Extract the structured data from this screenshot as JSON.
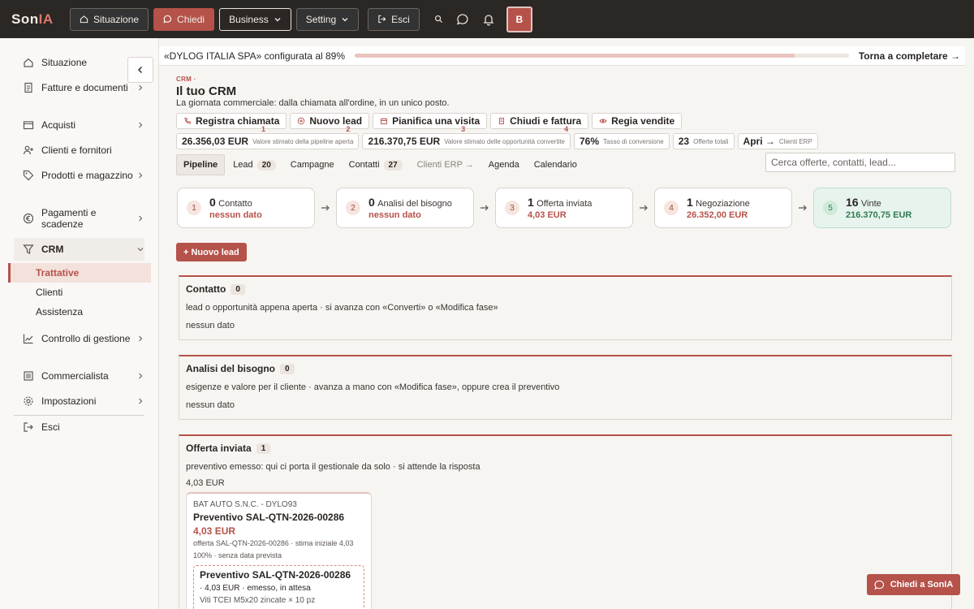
{
  "topbar": {
    "logo_left": "Son",
    "logo_right": "IA",
    "nav": [
      {
        "label": "Situazione",
        "icon": "home-icon"
      },
      {
        "label": "Chiedi",
        "icon": "chat-icon"
      },
      {
        "label": "Business",
        "icon": "chevron-down-icon"
      },
      {
        "label": "Setting",
        "icon": "chevron-down-icon"
      },
      {
        "label": "Esci",
        "icon": "logout-icon"
      }
    ],
    "avatar": "B",
    "colors": {
      "brand": "#b5524a",
      "bar": "#2b2725"
    }
  },
  "sidebar": {
    "items": [
      {
        "label": "Situazione",
        "icon": "home-icon"
      },
      {
        "label": "Fatture e documenti",
        "icon": "document-icon"
      },
      {
        "label": "Acquisti",
        "icon": "wallet-icon"
      },
      {
        "label": "Clienti e fornitori",
        "icon": "user-plus-icon"
      },
      {
        "label": "Prodotti e magazzino",
        "icon": "tag-icon"
      },
      {
        "label": "Pagamenti e scadenze",
        "icon": "euro-icon"
      },
      {
        "label": "CRM",
        "icon": "filter-icon"
      },
      {
        "label": "Controllo di gestione",
        "icon": "chart-icon"
      },
      {
        "label": "Commercialista",
        "icon": "ledger-icon"
      },
      {
        "label": "Impostazioni",
        "icon": "gear-icon"
      },
      {
        "label": "Esci",
        "icon": "logout-icon"
      }
    ],
    "crm_sub": [
      "Trattative",
      "Clienti",
      "Assistenza"
    ]
  },
  "banner": {
    "text": "«DYLOG ITALIA SPA» configurata al 89%",
    "progress": 0.89,
    "cta": "Torna a completare →"
  },
  "page": {
    "tag": "CRM ·",
    "title": "Il tuo CRM",
    "subtitle": "La giornata commerciale: dalla chiamata all'ordine, in un unico posto."
  },
  "actions": [
    {
      "label": "Registra chiamata",
      "num": "1",
      "icon": "phone-icon"
    },
    {
      "label": "Nuovo lead",
      "num": "2",
      "icon": "plus-circle-icon"
    },
    {
      "label": "Pianifica una visita",
      "num": "3",
      "icon": "calendar-icon"
    },
    {
      "label": "Chiudi e fattura",
      "num": "4",
      "icon": "invoice-icon"
    },
    {
      "label": "Regia vendite",
      "num": "",
      "icon": "eye-icon"
    }
  ],
  "kpis": [
    {
      "value": "26.356,03 EUR",
      "label": "Valore stimato della pipeline aperta"
    },
    {
      "value": "216.370,75 EUR",
      "label": "Valore stimato delle opportunità convertite"
    },
    {
      "value": "76%",
      "label": "Tasso di conversione"
    },
    {
      "value": "23",
      "label": "Offerte totali"
    },
    {
      "value": "Apri →",
      "label": "Clienti ERP"
    }
  ],
  "tabs": [
    {
      "label": "Pipeline",
      "count": ""
    },
    {
      "label": "Lead",
      "count": "20"
    },
    {
      "label": "Campagne",
      "count": ""
    },
    {
      "label": "Contatti",
      "count": "27"
    },
    {
      "label": "Clienti ERP →",
      "count": ""
    },
    {
      "label": "Agenda",
      "count": ""
    },
    {
      "label": "Calendario",
      "count": ""
    }
  ],
  "search": {
    "placeholder": "Cerca offerte, contatti, lead..."
  },
  "stages": [
    {
      "n": "1",
      "count": "0",
      "name": "Contatto",
      "value": "nessun dato"
    },
    {
      "n": "2",
      "count": "0",
      "name": "Analisi del bisogno",
      "value": "nessun dato"
    },
    {
      "n": "3",
      "count": "1",
      "name": "Offerta inviata",
      "value": "4,03 EUR"
    },
    {
      "n": "4",
      "count": "1",
      "name": "Negoziazione",
      "value": "26.352,00 EUR"
    },
    {
      "n": "5",
      "count": "16",
      "name": "Vinte",
      "value": "216.370,75 EUR"
    }
  ],
  "new_lead": "+ Nuovo lead",
  "sections": [
    {
      "title": "Contatto",
      "count": "0",
      "desc": "lead o opportunità appena aperta · si avanza con «Converti» o «Modifica fase»",
      "foot": "nessun dato"
    },
    {
      "title": "Analisi del bisogno",
      "count": "0",
      "desc": "esigenze e valore per il cliente · avanza a mano con «Modifica fase», oppure crea il preventivo",
      "foot": "nessun dato"
    },
    {
      "title": "Offerta inviata",
      "count": "1",
      "desc": "preventivo emesso: qui ci porta il gestionale da solo · si attende la risposta",
      "foot": "4,03 EUR"
    }
  ],
  "card": {
    "company": "BAT AUTO S.N.C. - DYLO93",
    "title": "Preventivo SAL-QTN-2026-00286",
    "value": "4,03 EUR",
    "meta": "offerta SAL-QTN-2026-00286 · stima iniziale 4,03",
    "prob": "100% · senza data prevista",
    "inner_title": "Preventivo SAL-QTN-2026-00286",
    "inner_status": "· 4,03 EUR · emesso, in attesa",
    "inner_extra": "Viti TCEI M5x20 zincate × 10 pz"
  },
  "float_button": "Chiedi a SonIA"
}
